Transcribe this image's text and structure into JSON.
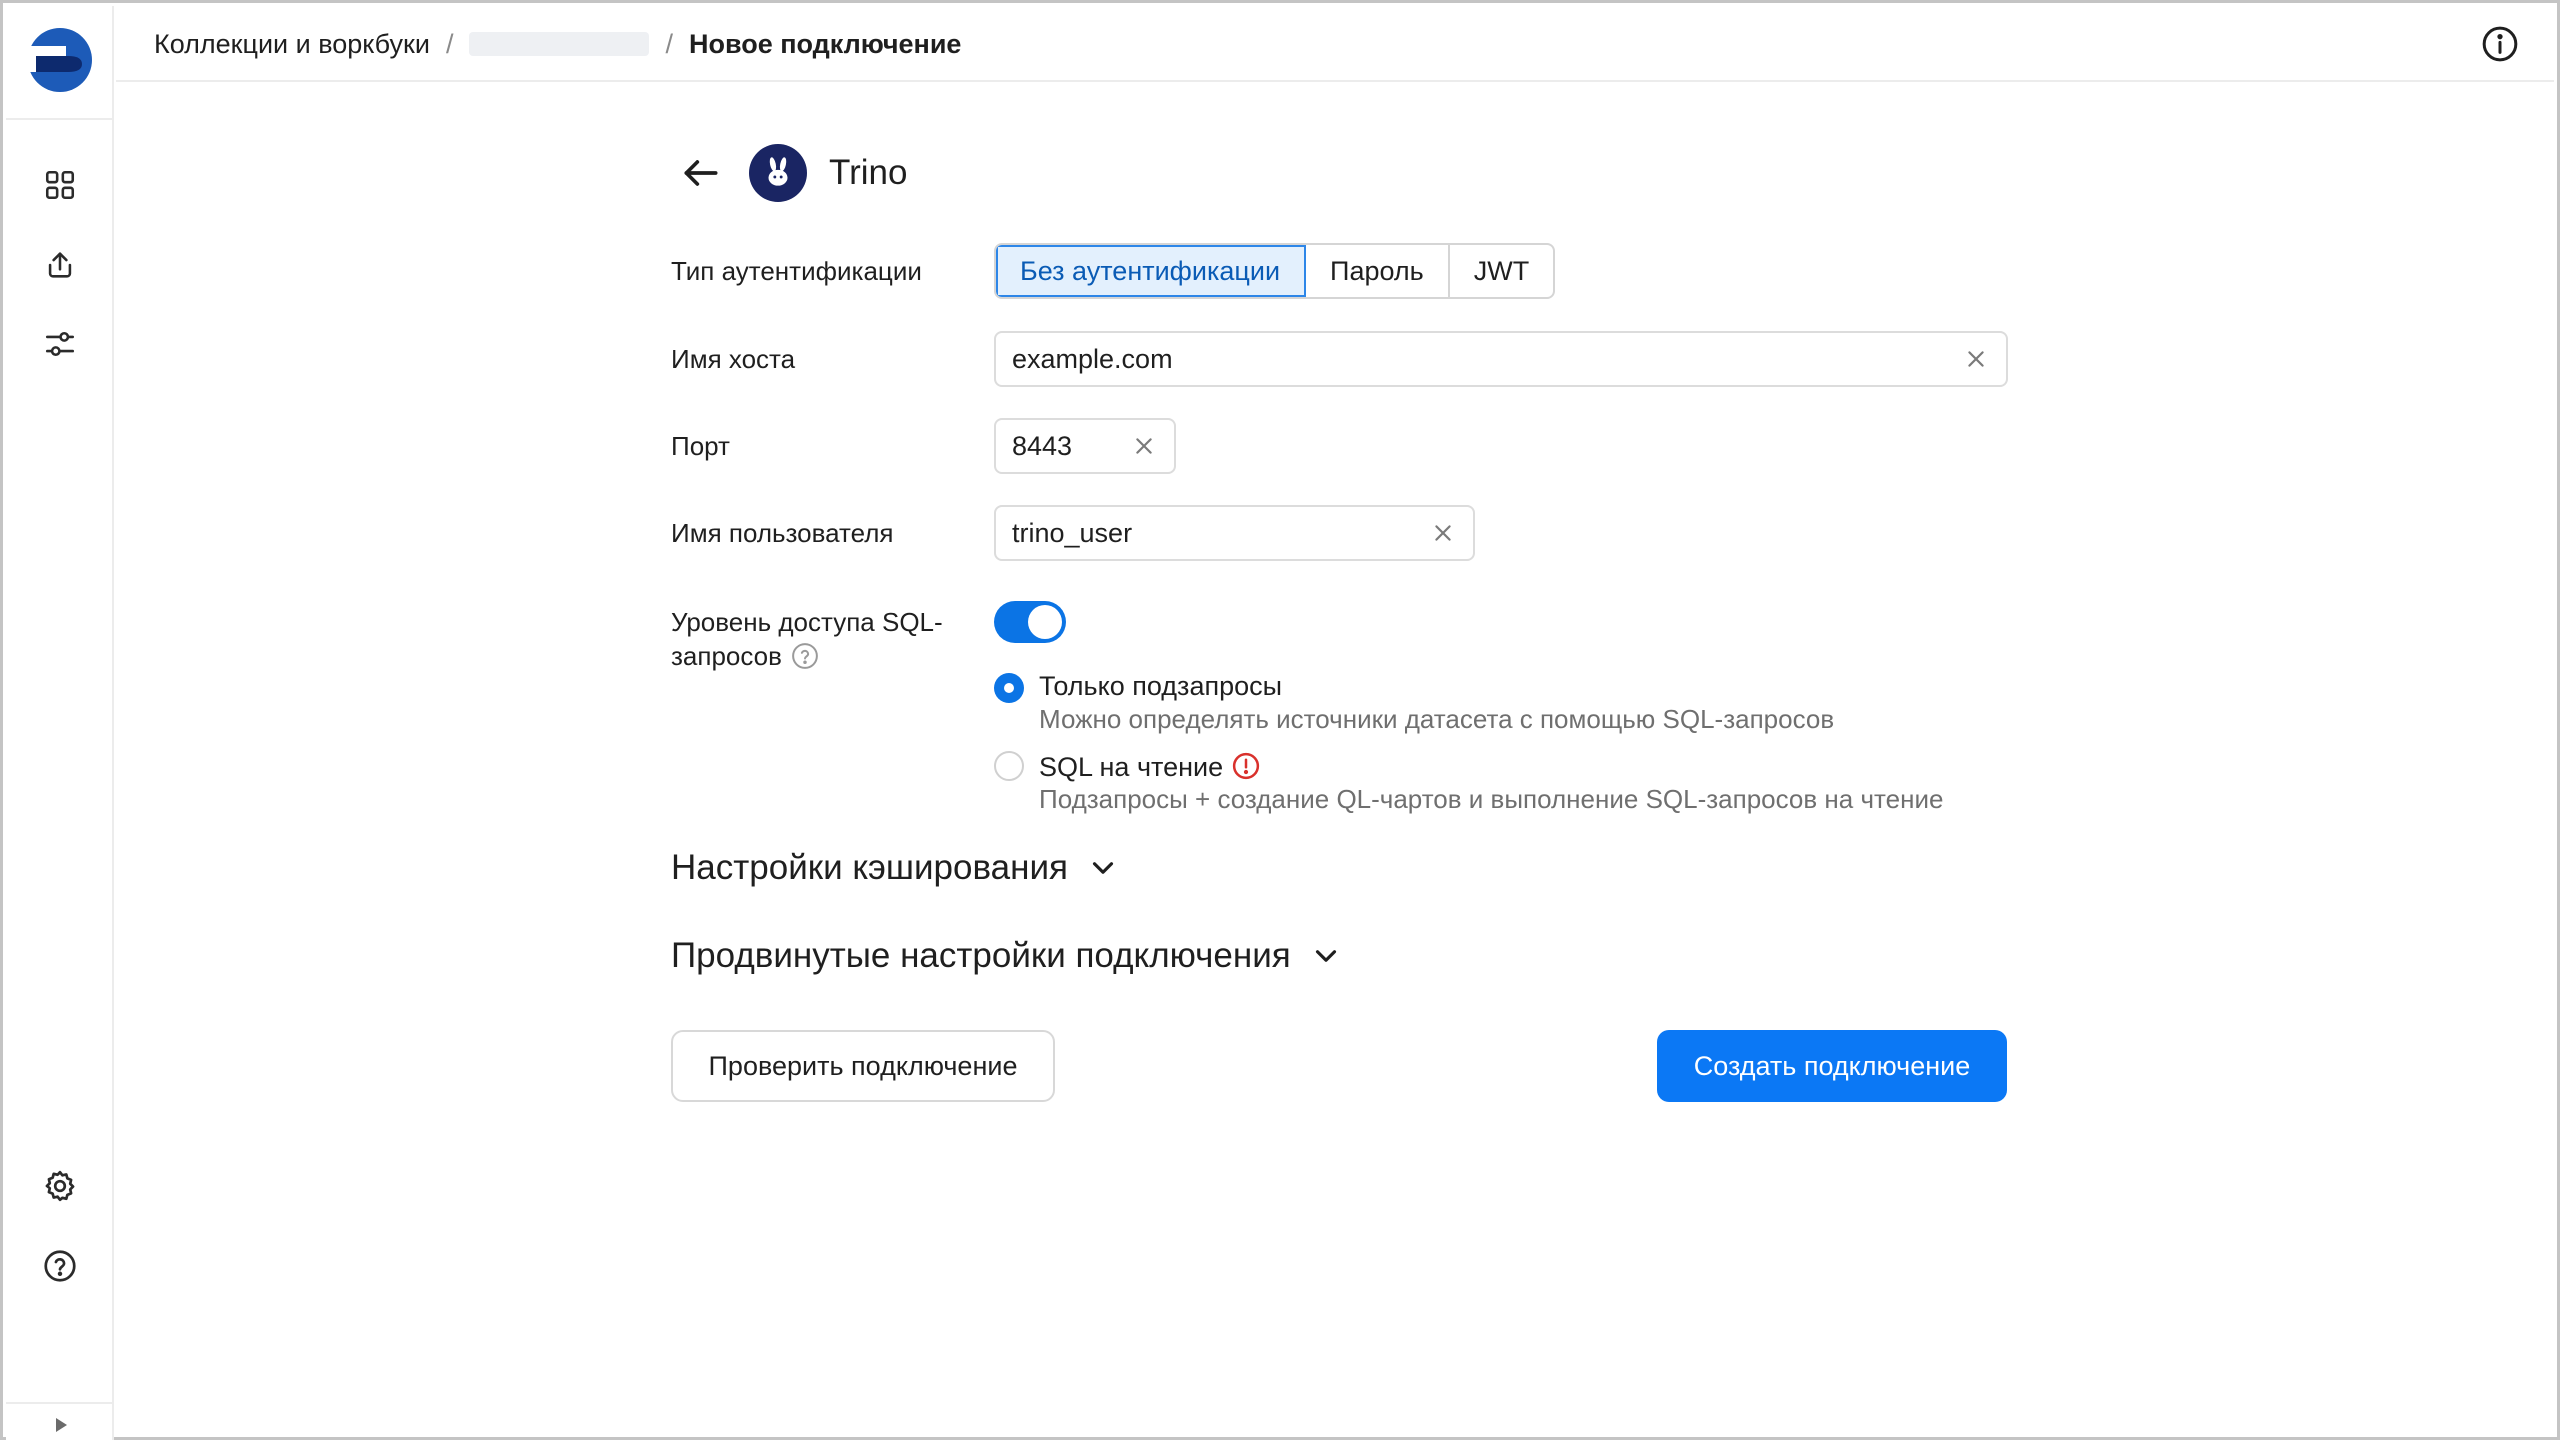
{
  "header": {
    "breadcrumb_root": "Коллекции и воркбуки",
    "breadcrumb_current": "Новое подключение",
    "separator": "/"
  },
  "sidebar": {
    "items": [
      "collections-grid-icon",
      "upload-icon",
      "sliders-icon"
    ],
    "bottom": [
      "settings-icon",
      "help-icon"
    ]
  },
  "page": {
    "title": "Trino"
  },
  "form": {
    "auth_label": "Тип аутентификации",
    "auth_options": [
      "Без аутентификации",
      "Пароль",
      "JWT"
    ],
    "auth_selected": "Без аутентификации",
    "host_label": "Имя хоста",
    "host_value": "example.com",
    "port_label": "Порт",
    "port_value": "8443",
    "user_label": "Имя пользователя",
    "user_value": "trino_user",
    "sql_level_label_1": "Уровень доступа SQL-",
    "sql_level_label_2": "запросов",
    "sql_toggle_on": true,
    "sql_options": [
      {
        "title": "Только подзапросы",
        "desc": "Можно определять источники датасета с помощью SQL-запросов",
        "checked": true
      },
      {
        "title": "SQL на чтение",
        "desc": "Подзапросы + создание QL-чартов и выполнение SQL-запросов на чтение",
        "checked": false
      }
    ]
  },
  "sections": {
    "cache": "Настройки кэширования",
    "advanced": "Продвинутые настройки подключения"
  },
  "actions": {
    "check": "Проверить подключение",
    "create": "Создать подключение"
  },
  "colors": {
    "primary": "#0b78f5",
    "selected_bg": "#e3f0fd",
    "warning": "#d9312c",
    "logo_blue": "#1d5bb8"
  }
}
